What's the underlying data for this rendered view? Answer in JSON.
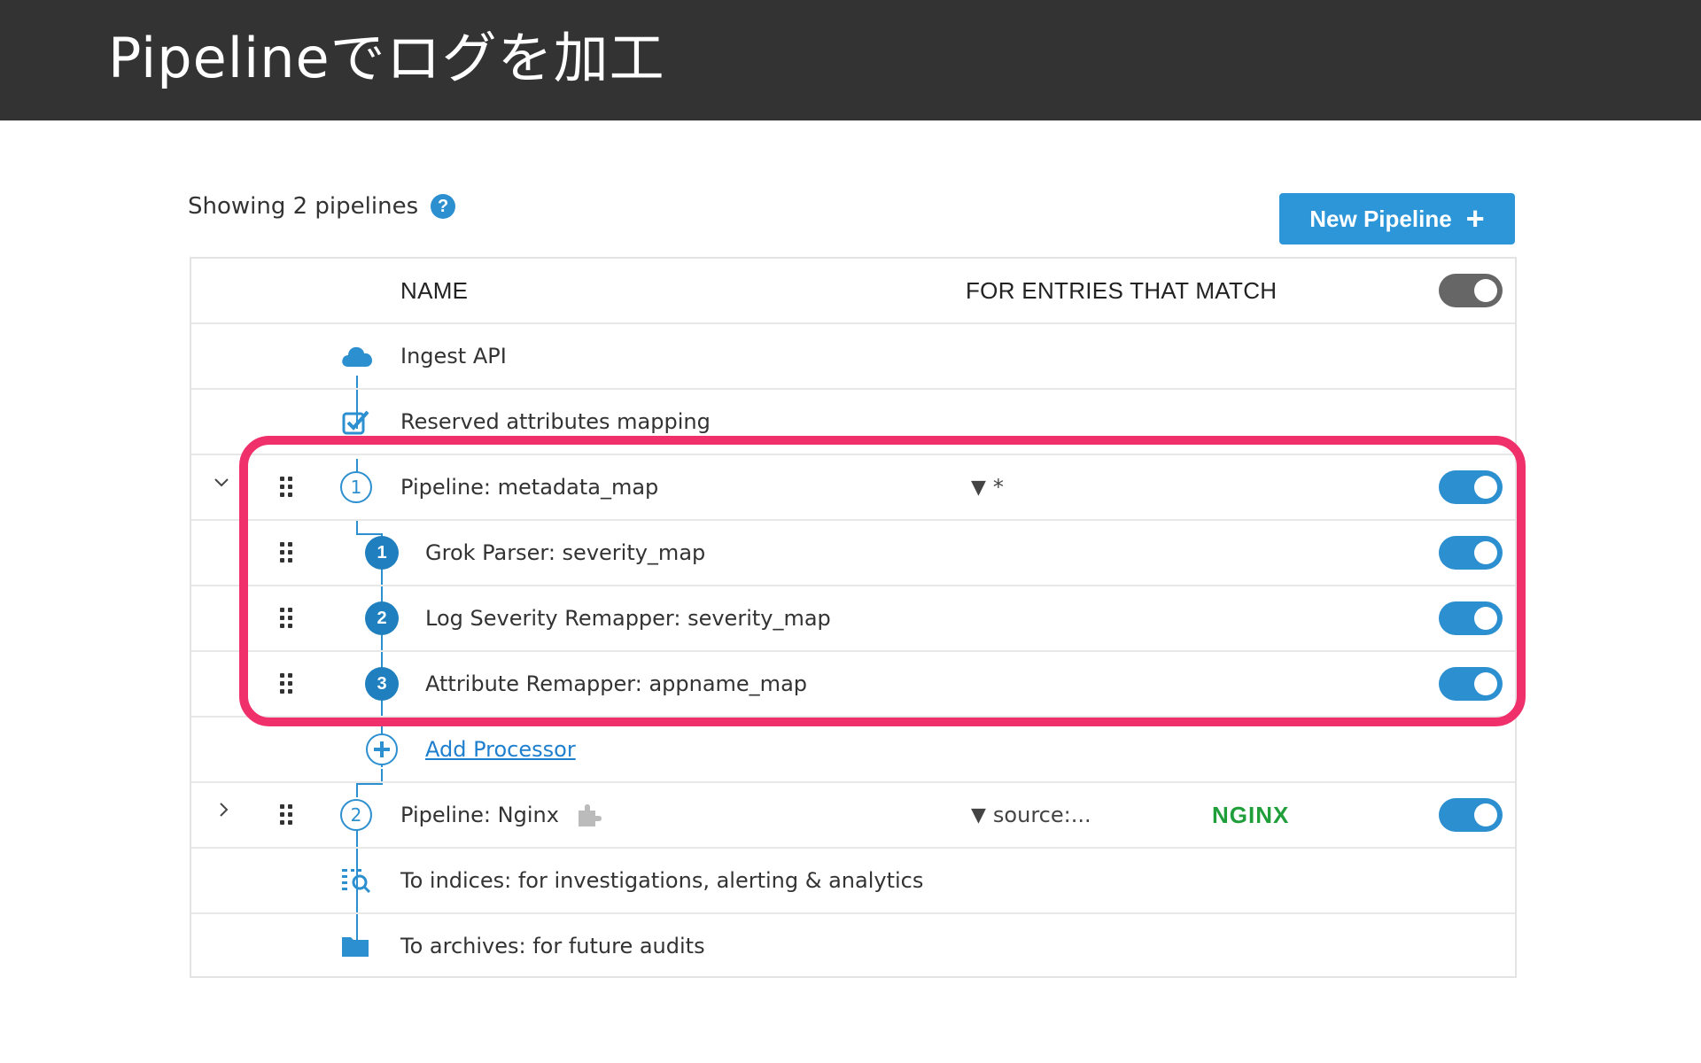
{
  "slide": {
    "title": "Pipelineでログを加工"
  },
  "header": {
    "showing_text": "Showing 2 pipelines",
    "new_pipeline_label": "New Pipeline",
    "new_pipeline_plus": "+"
  },
  "table": {
    "col_name": "NAME",
    "col_match": "FOR ENTRIES THAT MATCH",
    "header_toggle": "off"
  },
  "rows": {
    "ingest": "Ingest API",
    "reserved": "Reserved attributes mapping",
    "pipeline1": {
      "number": "1",
      "name": "Pipeline: metadata_map",
      "filter": "*",
      "enabled": true
    },
    "proc1": {
      "number": "1",
      "name": "Grok Parser: severity_map",
      "enabled": true
    },
    "proc2": {
      "number": "2",
      "name": "Log Severity Remapper: severity_map",
      "enabled": true
    },
    "proc3": {
      "number": "3",
      "name": "Attribute Remapper: appname_map",
      "enabled": true
    },
    "add_processor": "Add Processor",
    "pipeline2": {
      "number": "2",
      "name": "Pipeline: Nginx",
      "filter": "source:...",
      "integration": "NGINX",
      "enabled": true
    },
    "indices": "To indices: for investigations, alerting & analytics",
    "archives": "To archives: for future audits"
  },
  "colors": {
    "accent": "#2c8fd0",
    "highlight": "#f0306b",
    "nginx": "#1f9e3a",
    "topbar": "#333333"
  }
}
